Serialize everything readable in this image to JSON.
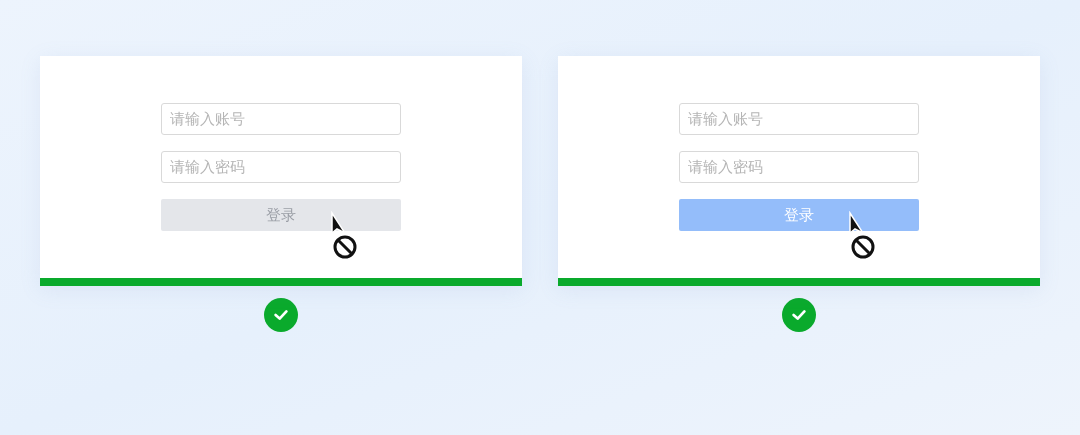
{
  "panels": [
    {
      "fields": [
        {
          "placeholder": "请输入账号"
        },
        {
          "placeholder": "请输入密码"
        }
      ],
      "button": {
        "label": "登录",
        "kind": "disabled"
      },
      "correct": true
    },
    {
      "fields": [
        {
          "placeholder": "请输入账号"
        },
        {
          "placeholder": "请输入密码"
        }
      ],
      "button": {
        "label": "登录",
        "kind": "primary"
      },
      "correct": true
    }
  ]
}
